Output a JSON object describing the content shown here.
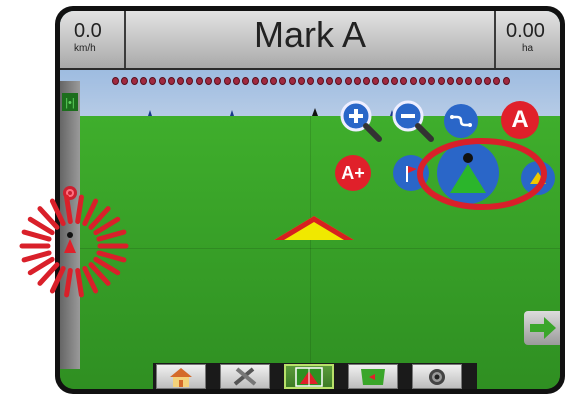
{
  "header": {
    "speed_value": "0.0",
    "speed_unit": "km/h",
    "title": "Mark A",
    "area_value": "0.00",
    "area_unit": "ha"
  },
  "map_controls": {
    "zoom_in": "zoom-in",
    "zoom_out": "zoom-out",
    "guidance_mode": "guidance-mode",
    "mark_a": "A",
    "a_plus_nudge": "A+",
    "return_to_point": "return-point",
    "view_vehicle": "vehicle-view",
    "view_perspective": "perspective-view"
  },
  "bottom_tabs": [
    {
      "name": "home",
      "icon": "home-icon"
    },
    {
      "name": "tools",
      "icon": "tools-icon"
    },
    {
      "name": "guidance",
      "icon": "guidance-icon",
      "active": true
    },
    {
      "name": "field",
      "icon": "field-icon"
    },
    {
      "name": "camera",
      "icon": "camera-icon"
    }
  ],
  "colors": {
    "accent_red": "#e0202a",
    "field_green": "#3fae2c",
    "vehicle_yellow": "#f0e800"
  }
}
